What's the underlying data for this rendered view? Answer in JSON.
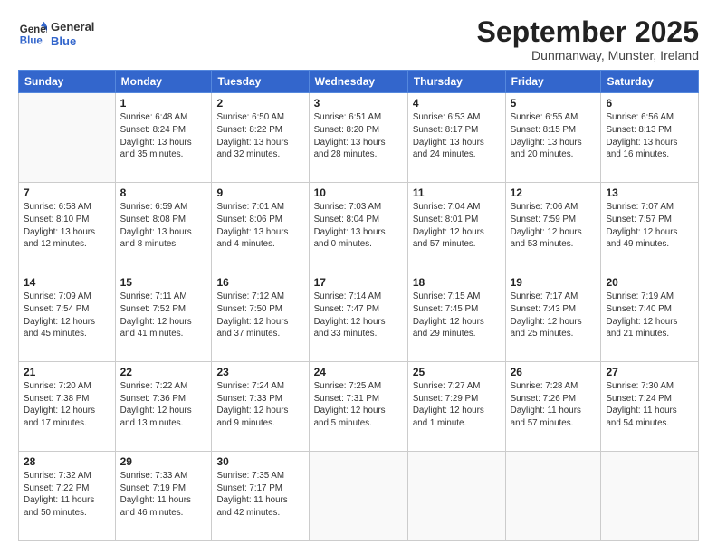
{
  "header": {
    "logo_line1": "General",
    "logo_line2": "Blue",
    "month_title": "September 2025",
    "location": "Dunmanway, Munster, Ireland"
  },
  "days_of_week": [
    "Sunday",
    "Monday",
    "Tuesday",
    "Wednesday",
    "Thursday",
    "Friday",
    "Saturday"
  ],
  "weeks": [
    [
      {
        "day": "",
        "info": ""
      },
      {
        "day": "1",
        "info": "Sunrise: 6:48 AM\nSunset: 8:24 PM\nDaylight: 13 hours\nand 35 minutes."
      },
      {
        "day": "2",
        "info": "Sunrise: 6:50 AM\nSunset: 8:22 PM\nDaylight: 13 hours\nand 32 minutes."
      },
      {
        "day": "3",
        "info": "Sunrise: 6:51 AM\nSunset: 8:20 PM\nDaylight: 13 hours\nand 28 minutes."
      },
      {
        "day": "4",
        "info": "Sunrise: 6:53 AM\nSunset: 8:17 PM\nDaylight: 13 hours\nand 24 minutes."
      },
      {
        "day": "5",
        "info": "Sunrise: 6:55 AM\nSunset: 8:15 PM\nDaylight: 13 hours\nand 20 minutes."
      },
      {
        "day": "6",
        "info": "Sunrise: 6:56 AM\nSunset: 8:13 PM\nDaylight: 13 hours\nand 16 minutes."
      }
    ],
    [
      {
        "day": "7",
        "info": "Sunrise: 6:58 AM\nSunset: 8:10 PM\nDaylight: 13 hours\nand 12 minutes."
      },
      {
        "day": "8",
        "info": "Sunrise: 6:59 AM\nSunset: 8:08 PM\nDaylight: 13 hours\nand 8 minutes."
      },
      {
        "day": "9",
        "info": "Sunrise: 7:01 AM\nSunset: 8:06 PM\nDaylight: 13 hours\nand 4 minutes."
      },
      {
        "day": "10",
        "info": "Sunrise: 7:03 AM\nSunset: 8:04 PM\nDaylight: 13 hours\nand 0 minutes."
      },
      {
        "day": "11",
        "info": "Sunrise: 7:04 AM\nSunset: 8:01 PM\nDaylight: 12 hours\nand 57 minutes."
      },
      {
        "day": "12",
        "info": "Sunrise: 7:06 AM\nSunset: 7:59 PM\nDaylight: 12 hours\nand 53 minutes."
      },
      {
        "day": "13",
        "info": "Sunrise: 7:07 AM\nSunset: 7:57 PM\nDaylight: 12 hours\nand 49 minutes."
      }
    ],
    [
      {
        "day": "14",
        "info": "Sunrise: 7:09 AM\nSunset: 7:54 PM\nDaylight: 12 hours\nand 45 minutes."
      },
      {
        "day": "15",
        "info": "Sunrise: 7:11 AM\nSunset: 7:52 PM\nDaylight: 12 hours\nand 41 minutes."
      },
      {
        "day": "16",
        "info": "Sunrise: 7:12 AM\nSunset: 7:50 PM\nDaylight: 12 hours\nand 37 minutes."
      },
      {
        "day": "17",
        "info": "Sunrise: 7:14 AM\nSunset: 7:47 PM\nDaylight: 12 hours\nand 33 minutes."
      },
      {
        "day": "18",
        "info": "Sunrise: 7:15 AM\nSunset: 7:45 PM\nDaylight: 12 hours\nand 29 minutes."
      },
      {
        "day": "19",
        "info": "Sunrise: 7:17 AM\nSunset: 7:43 PM\nDaylight: 12 hours\nand 25 minutes."
      },
      {
        "day": "20",
        "info": "Sunrise: 7:19 AM\nSunset: 7:40 PM\nDaylight: 12 hours\nand 21 minutes."
      }
    ],
    [
      {
        "day": "21",
        "info": "Sunrise: 7:20 AM\nSunset: 7:38 PM\nDaylight: 12 hours\nand 17 minutes."
      },
      {
        "day": "22",
        "info": "Sunrise: 7:22 AM\nSunset: 7:36 PM\nDaylight: 12 hours\nand 13 minutes."
      },
      {
        "day": "23",
        "info": "Sunrise: 7:24 AM\nSunset: 7:33 PM\nDaylight: 12 hours\nand 9 minutes."
      },
      {
        "day": "24",
        "info": "Sunrise: 7:25 AM\nSunset: 7:31 PM\nDaylight: 12 hours\nand 5 minutes."
      },
      {
        "day": "25",
        "info": "Sunrise: 7:27 AM\nSunset: 7:29 PM\nDaylight: 12 hours\nand 1 minute."
      },
      {
        "day": "26",
        "info": "Sunrise: 7:28 AM\nSunset: 7:26 PM\nDaylight: 11 hours\nand 57 minutes."
      },
      {
        "day": "27",
        "info": "Sunrise: 7:30 AM\nSunset: 7:24 PM\nDaylight: 11 hours\nand 54 minutes."
      }
    ],
    [
      {
        "day": "28",
        "info": "Sunrise: 7:32 AM\nSunset: 7:22 PM\nDaylight: 11 hours\nand 50 minutes."
      },
      {
        "day": "29",
        "info": "Sunrise: 7:33 AM\nSunset: 7:19 PM\nDaylight: 11 hours\nand 46 minutes."
      },
      {
        "day": "30",
        "info": "Sunrise: 7:35 AM\nSunset: 7:17 PM\nDaylight: 11 hours\nand 42 minutes."
      },
      {
        "day": "",
        "info": ""
      },
      {
        "day": "",
        "info": ""
      },
      {
        "day": "",
        "info": ""
      },
      {
        "day": "",
        "info": ""
      }
    ]
  ]
}
